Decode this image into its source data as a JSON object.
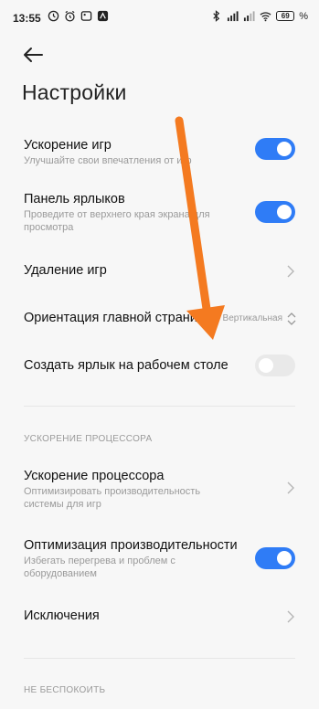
{
  "status_bar": {
    "time": "13:55",
    "battery_level": "69",
    "battery_pct_suffix": "%",
    "icons_left": [
      "clock-icon",
      "alarm-icon",
      "image-icon",
      "app-icon"
    ],
    "icons_right": [
      "bluetooth-icon",
      "signal-icon",
      "signal-icon",
      "wifi-icon",
      "battery-icon"
    ]
  },
  "header": {
    "title": "Настройки"
  },
  "settings": {
    "game_boost": {
      "title": "Ускорение игр",
      "subtitle": "Улучшайте свои впечатления от игр",
      "enabled": true
    },
    "shortcut_panel": {
      "title": "Панель ярлыков",
      "subtitle": "Проведите от верхнего края экрана для просмотра",
      "enabled": true
    },
    "remove_games": {
      "title": "Удаление игр"
    },
    "home_orientation": {
      "title": "Ориентация главной страницы",
      "value": "Вертикальная"
    },
    "desktop_shortcut": {
      "title": "Создать ярлык на рабочем столе",
      "enabled": false
    }
  },
  "cpu_section": {
    "header": "УСКОРЕНИЕ ПРОЦЕССОРА",
    "cpu_boost": {
      "title": "Ускорение процессора",
      "subtitle": "Оптимизировать производительность системы для игр"
    },
    "performance_opt": {
      "title": "Оптимизация производительности",
      "subtitle": "Избегать перегрева и проблем с оборудованием",
      "enabled": true
    },
    "exceptions": {
      "title": "Исключения"
    }
  },
  "dnd_section": {
    "header": "НЕ БЕСПОКОИТЬ"
  },
  "colors": {
    "accent": "#2f7cf6",
    "overlay_arrow": "#f47a20"
  }
}
